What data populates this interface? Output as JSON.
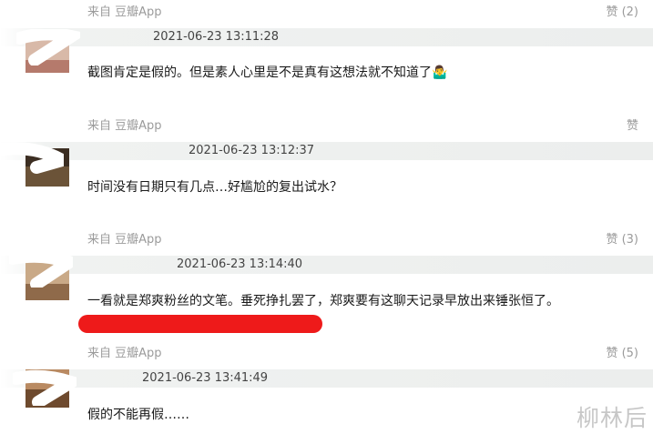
{
  "comments": [
    {
      "source": "来自 豆瓣App",
      "like": "赞 (2)",
      "timestamp": "2021-06-23 13:11:28",
      "text": "截图肯定是假的。但是素人心里是不是真有这想法就不知道了🤷‍♂️"
    },
    {
      "source": "来自 豆瓣App",
      "like": "赞",
      "timestamp": "2021-06-23 13:12:37",
      "text": "时间没有日期只有几点…好尴尬的复出试水？"
    },
    {
      "source": "来自 豆瓣App",
      "like": "赞 (3)",
      "timestamp": "2021-06-23 13:14:40",
      "text": "一看就是郑爽粉丝的文笔。垂死挣扎罢了，郑爽要有这聊天记录早放出来锤张恒了。"
    },
    {
      "source": "来自 豆瓣App",
      "like": "赞 (5)",
      "timestamp": "2021-06-23 13:41:49",
      "text": "假的不能再假……"
    }
  ],
  "watermark": "柳林后",
  "colors": {
    "redaction": "#ee1a1a",
    "header_band": "#eceeed"
  }
}
